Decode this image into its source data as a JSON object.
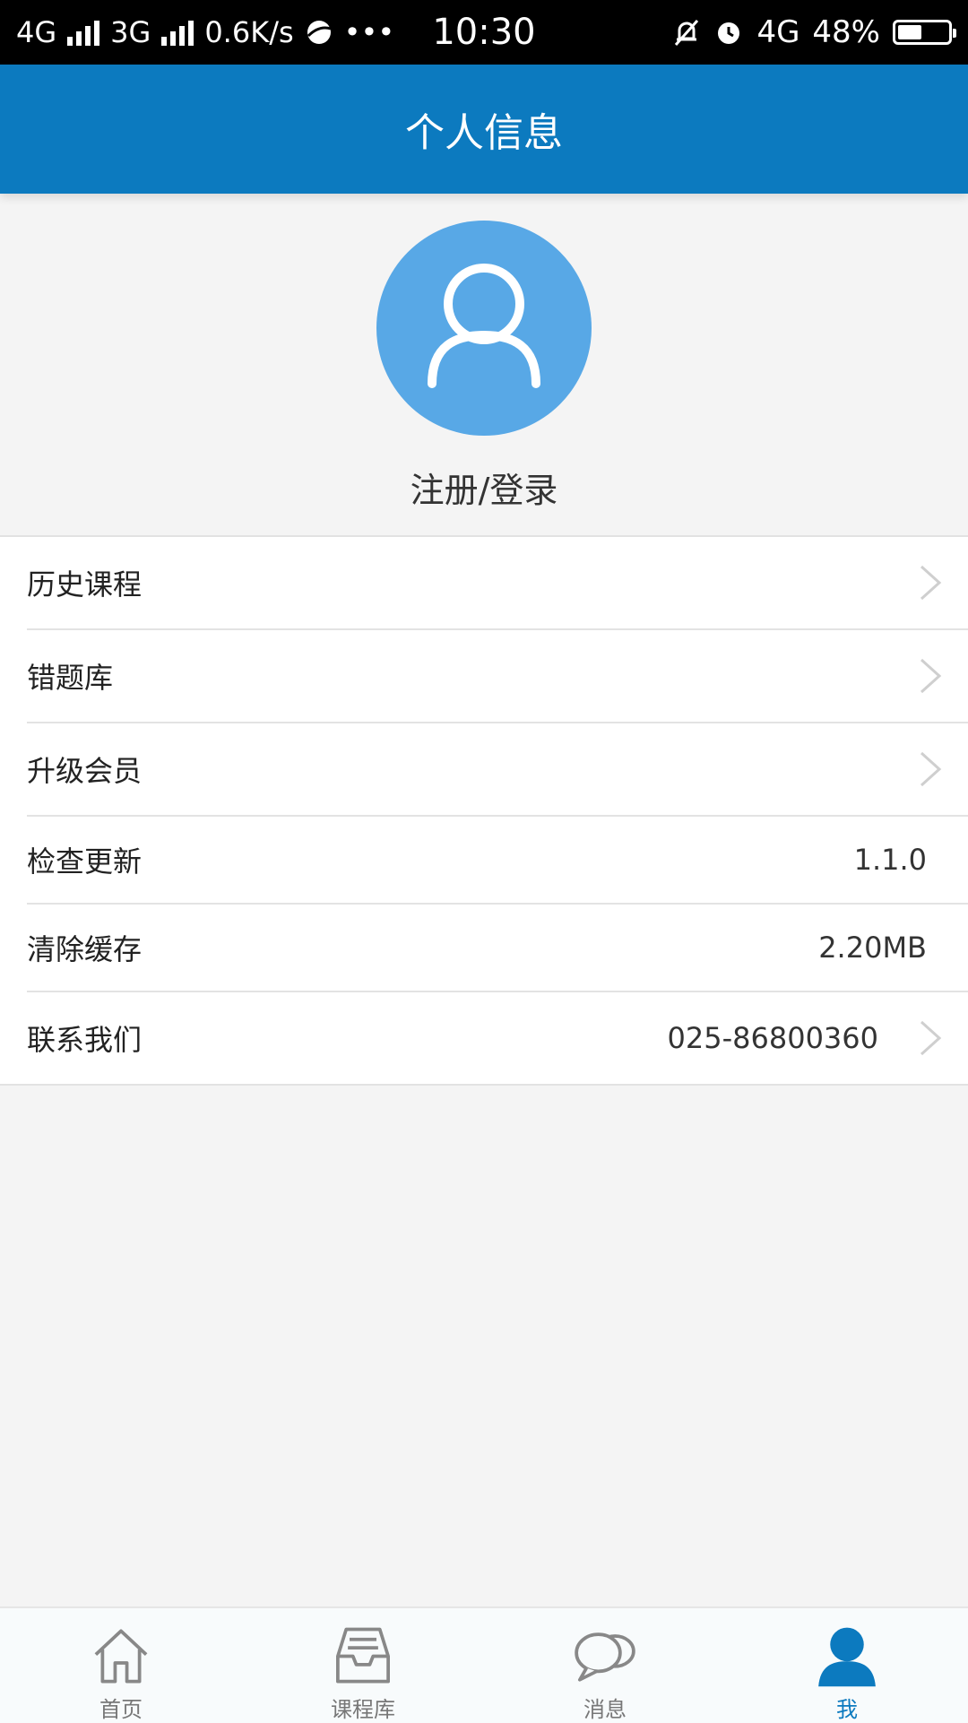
{
  "status_bar": {
    "network1": "4G",
    "network2": "3G",
    "speed": "0.6K/s",
    "dots": "•••",
    "time": "10:30",
    "network3": "4G",
    "battery_text": "48%",
    "battery_level": 0.48
  },
  "header": {
    "title": "个人信息"
  },
  "profile": {
    "login_label": "注册/登录"
  },
  "menu": {
    "items": [
      {
        "label": "历史课程",
        "value": ""
      },
      {
        "label": "错题库",
        "value": ""
      },
      {
        "label": "升级会员",
        "value": ""
      },
      {
        "label": "检查更新",
        "value": "1.1.0"
      },
      {
        "label": "清除缓存",
        "value": "2.20MB"
      },
      {
        "label": "联系我们",
        "value": "025-86800360"
      }
    ]
  },
  "tabbar": {
    "tabs": [
      {
        "label": "首页",
        "icon": "home-icon"
      },
      {
        "label": "课程库",
        "icon": "inbox-tray-icon"
      },
      {
        "label": "消息",
        "icon": "chat-bubbles-icon"
      },
      {
        "label": "我",
        "icon": "person-icon"
      }
    ],
    "active_index": 3
  },
  "colors": {
    "primary": "#0c7abf",
    "avatar_bg": "#58a8e6",
    "page_bg": "#f4f4f4"
  }
}
